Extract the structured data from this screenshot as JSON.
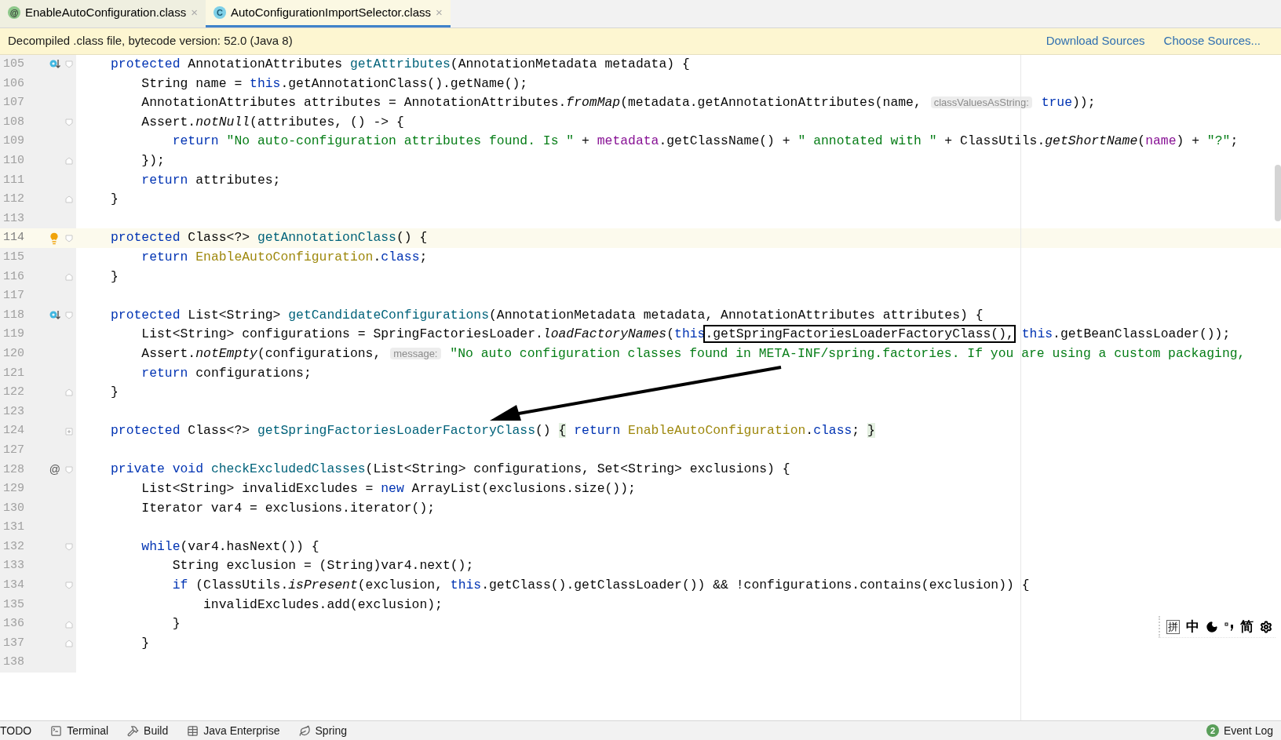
{
  "tabs": [
    {
      "label": "EnableAutoConfiguration.class",
      "icon_letter": "@",
      "kind": "annotation",
      "close": "×",
      "selected": false
    },
    {
      "label": "AutoConfigurationImportSelector.class",
      "icon_letter": "C",
      "kind": "class",
      "close": "×",
      "selected": true
    }
  ],
  "banner": {
    "message": "Decompiled .class file, bytecode version: 52.0 (Java 8)",
    "links": [
      "Download Sources",
      "Choose Sources..."
    ]
  },
  "editor": {
    "lines": [
      {
        "number": "105",
        "mark": {
          "kind": "override"
        },
        "fold_marker": {
          "kind": "start"
        },
        "current": false,
        "tokens": [
          {
            "text": "protected",
            "kind": "keyword"
          },
          {
            "text": " AnnotationAttributes ",
            "kind": "plain"
          },
          {
            "text": "getAttributes",
            "kind": "declaration"
          },
          {
            "text": "(AnnotationMetadata metadata) {",
            "kind": "plain"
          }
        ]
      },
      {
        "number": "106",
        "current": false,
        "tokens": [
          {
            "text": "    String name = ",
            "kind": "plain"
          },
          {
            "text": "this",
            "kind": "keyword"
          },
          {
            "text": ".getAnnotationClass().getName();",
            "kind": "plain"
          }
        ]
      },
      {
        "number": "107",
        "current": false,
        "tokens": [
          {
            "text": "    AnnotationAttributes attributes = AnnotationAttributes.",
            "kind": "plain"
          },
          {
            "text": "fromMap",
            "kind": "static"
          },
          {
            "text": "(metadata.getAnnotationAttributes(name, ",
            "kind": "plain"
          },
          {
            "text": "classValuesAsString:",
            "kind": "hint"
          },
          {
            "text": " true",
            "kind": "keyword"
          },
          {
            "text": "));",
            "kind": "plain"
          }
        ]
      },
      {
        "number": "108",
        "fold_marker": {
          "kind": "start"
        },
        "current": false,
        "tokens": [
          {
            "text": "    Assert.",
            "kind": "plain"
          },
          {
            "text": "notNull",
            "kind": "static"
          },
          {
            "text": "(attributes, () -> {",
            "kind": "plain"
          }
        ]
      },
      {
        "number": "109",
        "current": false,
        "tokens": [
          {
            "text": "        return",
            "kind": "keyword"
          },
          {
            "text": " \"No auto-configuration attributes found. Is \"",
            "kind": "string"
          },
          {
            "text": " + ",
            "kind": "plain"
          },
          {
            "text": "metadata",
            "kind": "variable"
          },
          {
            "text": ".getClassName() + ",
            "kind": "plain"
          },
          {
            "text": "\" annotated with \"",
            "kind": "string"
          },
          {
            "text": " + ClassUtils.",
            "kind": "plain"
          },
          {
            "text": "getShortName",
            "kind": "static"
          },
          {
            "text": "(",
            "kind": "plain"
          },
          {
            "text": "name",
            "kind": "variable"
          },
          {
            "text": ") + ",
            "kind": "plain"
          },
          {
            "text": "\"?\"",
            "kind": "string"
          },
          {
            "text": ";",
            "kind": "plain"
          }
        ]
      },
      {
        "number": "110",
        "fold_marker": {
          "kind": "end"
        },
        "current": false,
        "tokens": [
          {
            "text": "    });",
            "kind": "plain"
          }
        ]
      },
      {
        "number": "111",
        "current": false,
        "tokens": [
          {
            "text": "    return",
            "kind": "keyword"
          },
          {
            "text": " attributes;",
            "kind": "plain"
          }
        ]
      },
      {
        "number": "112",
        "fold_marker": {
          "kind": "end"
        },
        "current": false,
        "tokens": [
          {
            "text": "}",
            "kind": "plain"
          }
        ]
      },
      {
        "number": "113",
        "current": false
      },
      {
        "number": "114",
        "mark": {
          "kind": "bulb"
        },
        "fold_marker": {
          "kind": "start"
        },
        "current": true,
        "tokens": [
          {
            "text": "protected",
            "kind": "keyword"
          },
          {
            "text": " Class<?> ",
            "kind": "plain"
          },
          {
            "text": "getAnnotationClass",
            "kind": "declaration"
          },
          {
            "text": "() {",
            "kind": "plain"
          }
        ]
      },
      {
        "number": "115",
        "current": false,
        "tokens": [
          {
            "text": "    return",
            "kind": "keyword"
          },
          {
            "text": " EnableAutoConfiguration",
            "kind": "classref"
          },
          {
            "text": ".",
            "kind": "plain"
          },
          {
            "text": "class",
            "kind": "keyword"
          },
          {
            "text": ";",
            "kind": "plain"
          }
        ]
      },
      {
        "number": "116",
        "fold_marker": {
          "kind": "end"
        },
        "current": false,
        "tokens": [
          {
            "text": "}",
            "kind": "plain"
          }
        ]
      },
      {
        "number": "117",
        "current": false
      },
      {
        "number": "118",
        "mark": {
          "kind": "override"
        },
        "fold_marker": {
          "kind": "start"
        },
        "current": false,
        "tokens": [
          {
            "text": "protected",
            "kind": "keyword"
          },
          {
            "text": " List<String> ",
            "kind": "plain"
          },
          {
            "text": "getCandidateConfigurations",
            "kind": "declaration"
          },
          {
            "text": "(AnnotationMetadata metadata, AnnotationAttributes attributes) {",
            "kind": "plain"
          }
        ]
      },
      {
        "number": "119",
        "current": false,
        "tokens": [
          {
            "text": "    List<String> configurations = SpringFactoriesLoader.",
            "kind": "plain"
          },
          {
            "text": "loadFactoryNames",
            "kind": "static"
          },
          {
            "text": "(",
            "kind": "plain"
          },
          {
            "text": "this",
            "kind": "keyword"
          },
          {
            "text": ".getSpringFactoriesLoaderFactoryClass(),",
            "kind": "boxed"
          },
          {
            "text": " this",
            "kind": "keyword"
          },
          {
            "text": ".getBeanClassLoader());",
            "kind": "plain"
          }
        ]
      },
      {
        "number": "120",
        "current": false,
        "tokens": [
          {
            "text": "    Assert.",
            "kind": "plain"
          },
          {
            "text": "notEmpty",
            "kind": "static"
          },
          {
            "text": "(configurations, ",
            "kind": "plain"
          },
          {
            "text": "message:",
            "kind": "hint"
          },
          {
            "text": " \"No auto configuration classes found in META-INF/spring.factories. If you are using a custom packaging,",
            "kind": "string"
          }
        ]
      },
      {
        "number": "121",
        "current": false,
        "tokens": [
          {
            "text": "    return",
            "kind": "keyword"
          },
          {
            "text": " configurations;",
            "kind": "plain"
          }
        ]
      },
      {
        "number": "122",
        "fold_marker": {
          "kind": "end"
        },
        "current": false,
        "tokens": [
          {
            "text": "}",
            "kind": "plain"
          }
        ]
      },
      {
        "number": "123",
        "current": false
      },
      {
        "number": "124",
        "fold_marker": {
          "kind": "collapsed"
        },
        "current": false,
        "tokens": [
          {
            "text": "protected",
            "kind": "keyword"
          },
          {
            "text": " Class<?> ",
            "kind": "plain"
          },
          {
            "text": "getSpringFactoriesLoaderFactoryClass",
            "kind": "declaration"
          },
          {
            "text": "() ",
            "kind": "plain"
          },
          {
            "text": "{",
            "kind": "folded"
          },
          {
            "text": " return",
            "kind": "keyword"
          },
          {
            "text": " EnableAutoConfiguration",
            "kind": "classref"
          },
          {
            "text": ".",
            "kind": "plain"
          },
          {
            "text": "class",
            "kind": "keyword"
          },
          {
            "text": "; ",
            "kind": "plain"
          },
          {
            "text": "}",
            "kind": "folded"
          }
        ]
      },
      {
        "number": "127",
        "current": false
      },
      {
        "number": "128",
        "mark": {
          "kind": "text",
          "text": "@"
        },
        "fold_marker": {
          "kind": "start"
        },
        "current": false,
        "tokens": [
          {
            "text": "private void",
            "kind": "keyword"
          },
          {
            "text": " checkExcludedClasses",
            "kind": "declaration"
          },
          {
            "text": "(List<String> configurations, Set<String> exclusions) {",
            "kind": "plain"
          }
        ]
      },
      {
        "number": "129",
        "current": false,
        "tokens": [
          {
            "text": "    List<String> invalidExcludes = ",
            "kind": "plain"
          },
          {
            "text": "new",
            "kind": "keyword"
          },
          {
            "text": " ArrayList(exclusions.size());",
            "kind": "plain"
          }
        ]
      },
      {
        "number": "130",
        "current": false,
        "tokens": [
          {
            "text": "    Iterator var4 = exclusions.iterator();",
            "kind": "plain"
          }
        ]
      },
      {
        "number": "131",
        "current": false
      },
      {
        "number": "132",
        "fold_marker": {
          "kind": "start"
        },
        "current": false,
        "tokens": [
          {
            "text": "    while",
            "kind": "keyword"
          },
          {
            "text": "(var4.hasNext()) {",
            "kind": "plain"
          }
        ]
      },
      {
        "number": "133",
        "current": false,
        "tokens": [
          {
            "text": "        String exclusion = (String)var4.next();",
            "kind": "plain"
          }
        ]
      },
      {
        "number": "134",
        "fold_marker": {
          "kind": "start"
        },
        "current": false,
        "tokens": [
          {
            "text": "        if",
            "kind": "keyword"
          },
          {
            "text": " (ClassUtils.",
            "kind": "plain"
          },
          {
            "text": "isPresent",
            "kind": "static"
          },
          {
            "text": "(exclusion, ",
            "kind": "plain"
          },
          {
            "text": "this",
            "kind": "keyword"
          },
          {
            "text": ".getClass().getClassLoader()) && !configurations.contains(exclusion)) {",
            "kind": "plain"
          }
        ]
      },
      {
        "number": "135",
        "current": false,
        "tokens": [
          {
            "text": "            invalidExcludes.add(exclusion);",
            "kind": "plain"
          }
        ]
      },
      {
        "number": "136",
        "fold_marker": {
          "kind": "end"
        },
        "current": false,
        "tokens": [
          {
            "text": "        }",
            "kind": "plain"
          }
        ]
      },
      {
        "number": "137",
        "fold_marker": {
          "kind": "end"
        },
        "current": false,
        "tokens": [
          {
            "text": "    }",
            "kind": "plain"
          }
        ]
      },
      {
        "number": "138",
        "current": false
      }
    ]
  },
  "ime_toolbar": [
    {
      "kind": "box",
      "text": "拼"
    },
    {
      "kind": "text",
      "text": "中"
    },
    {
      "kind": "moon"
    },
    {
      "kind": "punct"
    },
    {
      "kind": "text",
      "text": "简"
    },
    {
      "kind": "gear"
    }
  ],
  "status_bar": {
    "left": [
      {
        "label": "TODO"
      },
      {
        "label": "Terminal"
      },
      {
        "label": "Build"
      },
      {
        "label": "Java Enterprise"
      },
      {
        "label": "Spring"
      }
    ],
    "right": {
      "badge": "2",
      "label": "Event Log"
    }
  }
}
